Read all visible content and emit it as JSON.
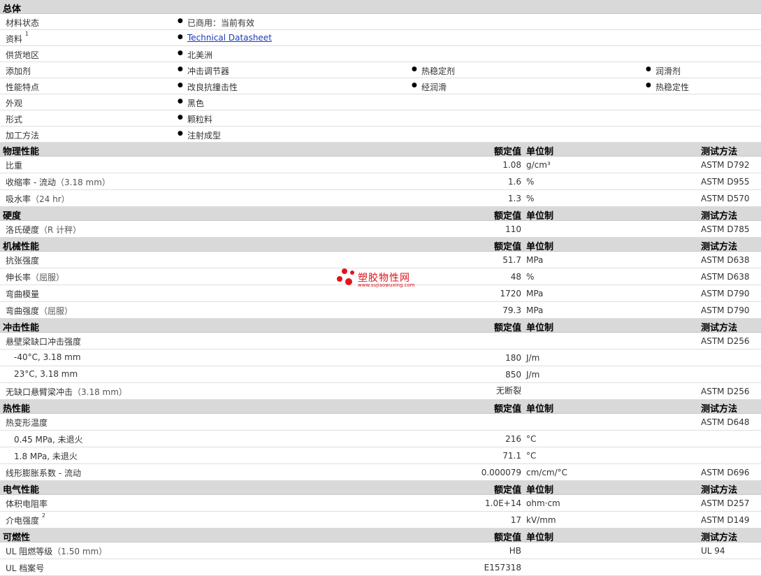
{
  "general": {
    "title": "总体",
    "material_status": {
      "label": "材料状态",
      "value": "已商用：当前有效"
    },
    "literature": {
      "label": "资料",
      "note": "1",
      "link": "Technical Datasheet"
    },
    "availability": {
      "label": "供货地区",
      "value": "北美洲"
    },
    "additives": {
      "label": "添加剂",
      "values": [
        "冲击调节器",
        "热稳定剂",
        "润滑剂"
      ]
    },
    "features": {
      "label": "性能特点",
      "values": [
        "改良抗撞击性",
        "经润滑",
        "热稳定性"
      ]
    },
    "appearance": {
      "label": "外观",
      "value": "黑色"
    },
    "form": {
      "label": "形式",
      "value": "颗粒料"
    },
    "processing": {
      "label": "加工方法",
      "value": "注射成型"
    }
  },
  "column_headers": {
    "value": "额定值",
    "unit": "单位制",
    "method": "测试方法"
  },
  "physical": {
    "title": "物理性能",
    "rows": [
      {
        "label": "比重",
        "cond": "",
        "value": "1.08",
        "unit": "g/cm³",
        "method": "ASTM D792"
      },
      {
        "label": "收缩率 - 流动",
        "cond": "（3.18 mm）",
        "value": "1.6",
        "unit": "%",
        "method": "ASTM D955"
      },
      {
        "label": "吸水率",
        "cond": "（24 hr）",
        "value": "1.3",
        "unit": "%",
        "method": "ASTM D570"
      }
    ]
  },
  "hardness": {
    "title": "硬度",
    "rows": [
      {
        "label": "洛氏硬度",
        "cond": "（R 计秤）",
        "value": "110",
        "unit": "",
        "method": "ASTM D785"
      }
    ]
  },
  "mechanical": {
    "title": "机械性能",
    "rows": [
      {
        "label": "抗张强度",
        "cond": "",
        "value": "51.7",
        "unit": "MPa",
        "method": "ASTM D638"
      },
      {
        "label": "伸长率",
        "cond": "（屈服）",
        "value": "48",
        "unit": "%",
        "method": "ASTM D638"
      },
      {
        "label": "弯曲模量",
        "cond": "",
        "value": "1720",
        "unit": "MPa",
        "method": "ASTM D790"
      },
      {
        "label": "弯曲强度",
        "cond": "（屈服）",
        "value": "79.3",
        "unit": "MPa",
        "method": "ASTM D790"
      }
    ]
  },
  "impact": {
    "title": "冲击性能",
    "notched": {
      "label": "悬壁梁缺口冲击强度",
      "method": "ASTM D256"
    },
    "rows": [
      {
        "label": "-40°C, 3.18 mm",
        "value": "180",
        "unit": "J/m"
      },
      {
        "label": "23°C, 3.18 mm",
        "value": "850",
        "unit": "J/m"
      }
    ],
    "unnotched": {
      "label": "无缺口悬臂梁冲击",
      "cond": "（3.18 mm）",
      "value": "无断裂",
      "method": "ASTM D256"
    }
  },
  "thermal": {
    "title": "热性能",
    "hdt": {
      "label": "热变形温度",
      "method": "ASTM D648"
    },
    "rows": [
      {
        "label": "0.45 MPa, 未退火",
        "value": "216",
        "unit": "°C"
      },
      {
        "label": "1.8 MPa, 未退火",
        "value": "71.1",
        "unit": "°C"
      }
    ],
    "clte": {
      "label": "线形膨胀系数 - 流动",
      "value": "0.000079",
      "unit": "cm/cm/°C",
      "method": "ASTM D696"
    }
  },
  "electrical": {
    "title": "电气性能",
    "volume_resistivity": {
      "label": "体积电阻率",
      "value": "1.0E+14",
      "unit": "ohm·cm",
      "method": "ASTM D257"
    },
    "dielectric_strength": {
      "label": "介电强度",
      "note": "2",
      "value": "17",
      "unit": "kV/mm",
      "method": "ASTM D149"
    }
  },
  "flammability": {
    "title": "可燃性",
    "ul_rating": {
      "label": "UL 阻燃等级",
      "cond": "（1.50 mm）",
      "value": "HB",
      "method": "UL 94"
    },
    "ul_file": {
      "label": "UL 档案号",
      "value": "E157318"
    }
  },
  "watermark": {
    "name": "塑胶物性网",
    "url": "www.sujiaowuxing.com",
    "color": "#e3141b"
  }
}
